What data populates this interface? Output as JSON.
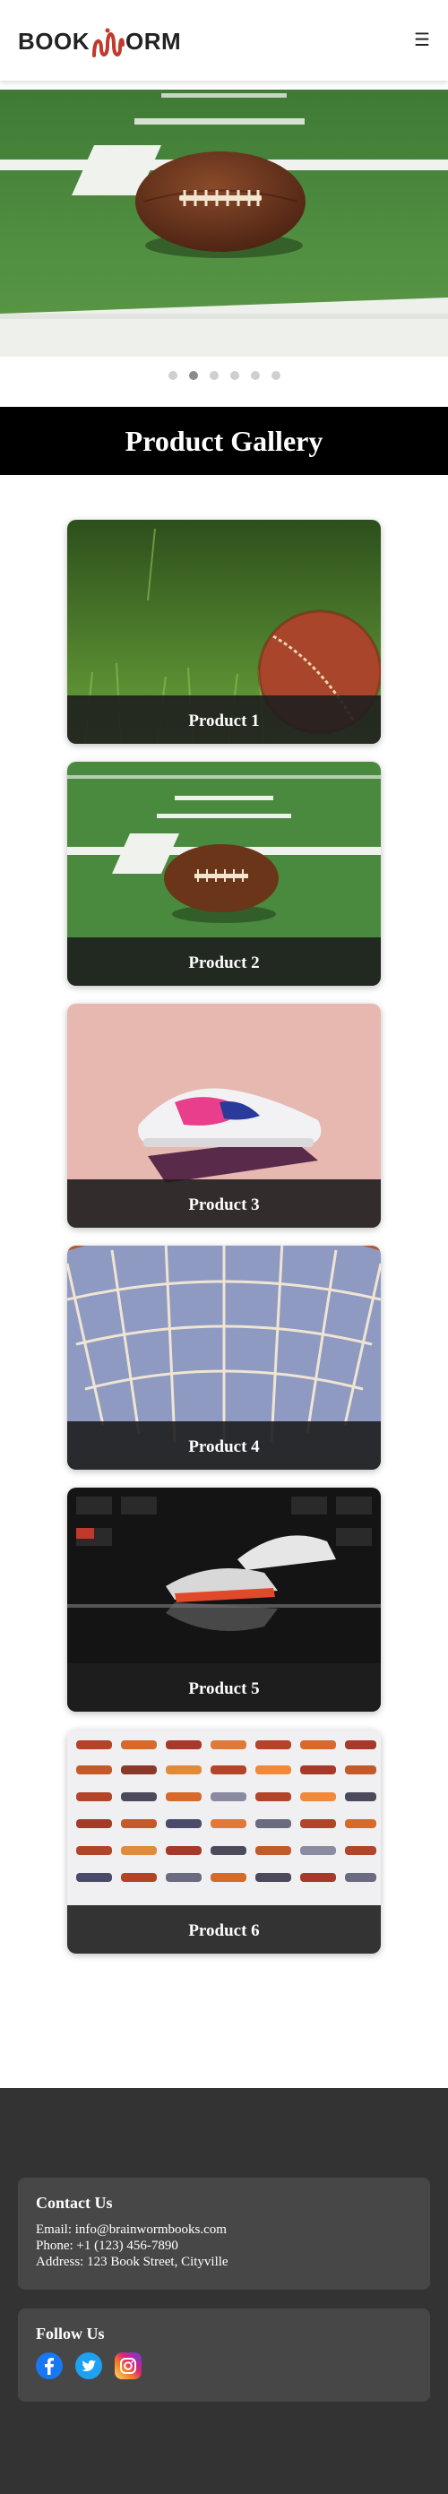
{
  "header": {
    "logo_left": "BOOK",
    "logo_right": "ORM",
    "menu_icon": "☰"
  },
  "slider": {
    "slide_count": 6,
    "active_index": 1
  },
  "gallery": {
    "title": "Product Gallery",
    "products": [
      {
        "label": "Product 1",
        "image": "cricket-ball-on-grass"
      },
      {
        "label": "Product 2",
        "image": "football-on-field"
      },
      {
        "label": "Product 3",
        "image": "pink-sneaker"
      },
      {
        "label": "Product 4",
        "image": "basketball-hoop-net"
      },
      {
        "label": "Product 5",
        "image": "sneakers-on-display"
      },
      {
        "label": "Product 6",
        "image": "sneaker-wall"
      }
    ]
  },
  "footer": {
    "contact": {
      "heading": "Contact Us",
      "email": "Email: info@brainwormbooks.com",
      "phone": "Phone: +1 (123) 456-7890",
      "address": "Address: 123 Book Street, Cityville"
    },
    "follow": {
      "heading": "Follow Us",
      "icons": [
        "facebook-icon",
        "twitter-icon",
        "instagram-icon"
      ]
    }
  },
  "colors": {
    "accent": "#c0392b",
    "gallery_title_bg": "#000000",
    "footer_bg": "#333333",
    "footer_box_bg": "#474747",
    "facebook": "#1877f2",
    "twitter": "#1da1f2"
  }
}
